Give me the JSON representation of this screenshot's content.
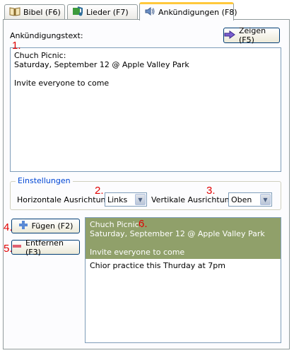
{
  "tabs": [
    {
      "label": "Bibel (F6)",
      "icon": "book-icon"
    },
    {
      "label": "Lieder (F7)",
      "icon": "music-icon"
    },
    {
      "label": "Ankündigungen (F8)",
      "icon": "speaker-icon",
      "active": true
    }
  ],
  "announcement": {
    "label": "Ankündigungstext:",
    "show_button": "Zeigen (F5)",
    "text": "Chuch Picnic:\nSaturday, September 12 @ Apple Valley Park\n\nInvite everyone to come"
  },
  "settings": {
    "title": "Einstellungen",
    "horizontal_label": "Horizontale Ausrichtung:",
    "horizontal_value": "Links",
    "vertical_label": "Vertikale Ausrichtung:",
    "vertical_value": "Oben"
  },
  "buttons": {
    "add": "Fügen (F2)",
    "remove": "Entfernen (F3)"
  },
  "list": {
    "items": [
      {
        "text": "Chuch Picnic:\nSaturday, September 12 @ Apple Valley Park\n\nInvite everyone to come",
        "selected": true
      },
      {
        "text": "Chior practice this Thurday at 7pm",
        "selected": false
      }
    ]
  },
  "markers": [
    "1.",
    "2.",
    "3.",
    "4.",
    "5.",
    "6."
  ],
  "colors": {
    "selection": "#90a06a",
    "marker": "#e00000",
    "tab_highlight": "#ffc83c"
  }
}
